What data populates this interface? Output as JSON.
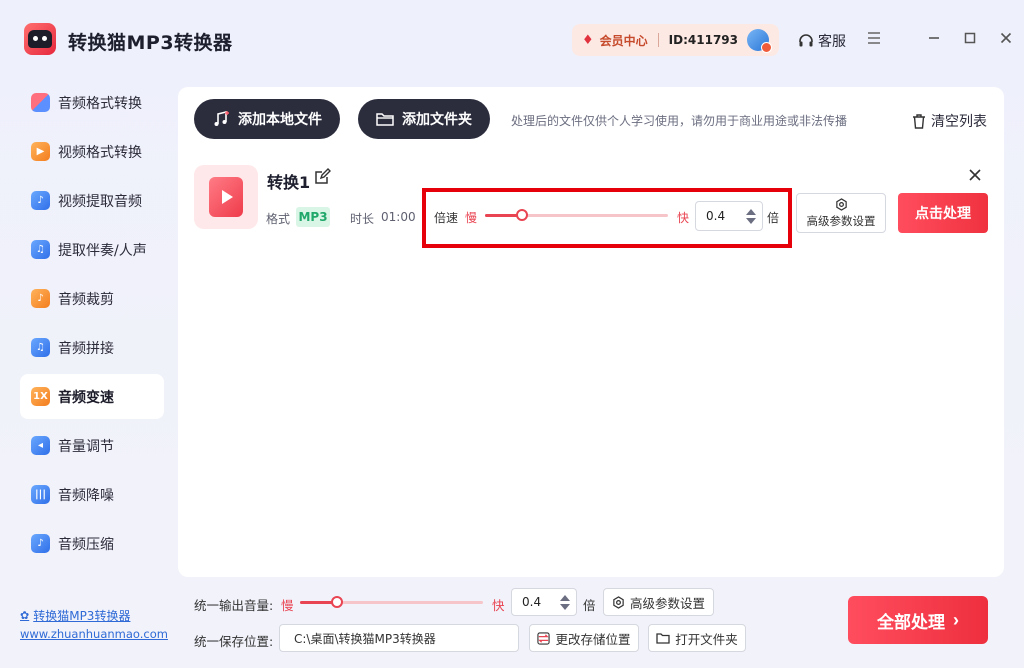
{
  "app": {
    "title": "转换猫MP3转换器",
    "vip_label": "会员中心",
    "user_id": "ID:411793",
    "service_label": "客服"
  },
  "sidebar": {
    "items": [
      {
        "label": "音频格式转换",
        "icon": "audio-format-icon"
      },
      {
        "label": "视频格式转换",
        "icon": "video-format-icon"
      },
      {
        "label": "视频提取音频",
        "icon": "video-extract-icon"
      },
      {
        "label": "提取伴奏/人声",
        "icon": "vocal-extract-icon"
      },
      {
        "label": "音频裁剪",
        "icon": "audio-cut-icon"
      },
      {
        "label": "音频拼接",
        "icon": "audio-merge-icon"
      },
      {
        "label": "音频变速",
        "icon": "audio-speed-icon",
        "badge": "1X",
        "active": true
      },
      {
        "label": "音量调节",
        "icon": "volume-icon"
      },
      {
        "label": "音频降噪",
        "icon": "denoise-icon"
      },
      {
        "label": "音频压缩",
        "icon": "compress-icon"
      }
    ],
    "footer_link": "转换猫MP3转换器",
    "footer_url": "www.zhuanhuanmao.com"
  },
  "toolbar": {
    "add_file": "添加本地文件",
    "add_folder": "添加文件夹",
    "notice": "处理后的文件仅供个人学习使用，请勿用于商业用途或非法传播",
    "clear": "清空列表"
  },
  "file": {
    "name": "转换1",
    "format_label": "格式",
    "format": "MP3",
    "duration_label": "时长",
    "duration": "01:00",
    "speed_label": "倍速",
    "slow": "慢",
    "fast": "快",
    "speed_value": "0.4",
    "speed_fraction": 0.2,
    "unit": "倍",
    "advanced": "高级参数设置",
    "process": "点击处理"
  },
  "bottom": {
    "volume_label": "统一输出音量:",
    "slow": "慢",
    "fast": "快",
    "volume_value": "0.4",
    "volume_fraction": 0.2,
    "unit": "倍",
    "advanced": "高级参数设置",
    "save_label": "统一保存位置:",
    "save_path": "C:\\桌面\\转换猫MP3转换器",
    "change_location": "更改存储位置",
    "open_folder": "打开文件夹",
    "process_all": "全部处理"
  },
  "colors": {
    "accent": "#ef3b4a",
    "dark_button": "#2b2d3d",
    "highlight_box": "#e6000a",
    "link": "#2f6ad6"
  }
}
